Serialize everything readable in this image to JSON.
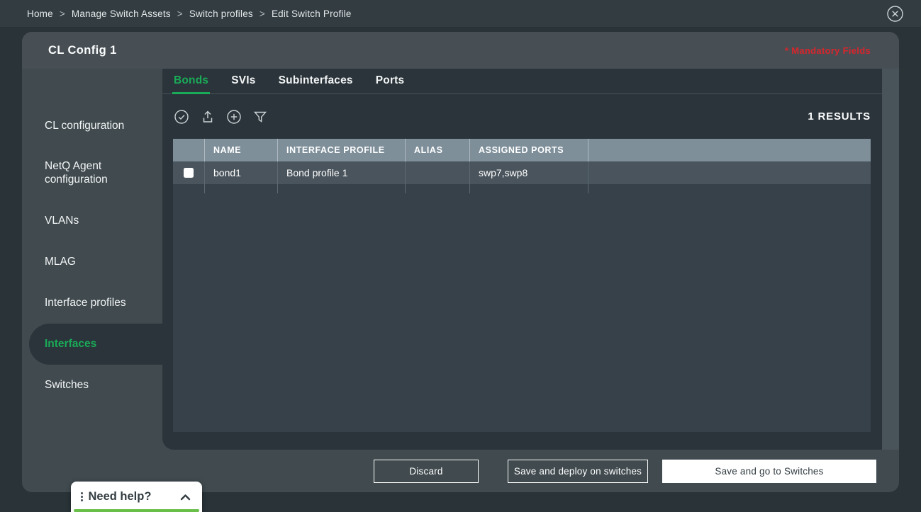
{
  "topbar": {
    "breadcrumb": [
      "Home",
      "Manage Switch Assets",
      "Switch profiles",
      "Edit Switch Profile"
    ],
    "separator": ">"
  },
  "panel": {
    "title": "CL Config 1",
    "mandatory_note": "* Mandatory Fields"
  },
  "sidebar": {
    "items": [
      {
        "label": "CL configuration",
        "selected": false
      },
      {
        "label": "NetQ Agent configuration",
        "selected": false
      },
      {
        "label": "VLANs",
        "selected": false
      },
      {
        "label": "MLAG",
        "selected": false
      },
      {
        "label": "Interface profiles",
        "selected": false
      },
      {
        "label": "Interfaces",
        "selected": true
      },
      {
        "label": "Switches",
        "selected": false
      }
    ]
  },
  "tabs": [
    {
      "label": "Bonds",
      "active": true
    },
    {
      "label": "SVIs",
      "active": false
    },
    {
      "label": "Subinterfaces",
      "active": false
    },
    {
      "label": "Ports",
      "active": false
    }
  ],
  "toolbar": {
    "icons": [
      "select-check-icon",
      "upload-icon",
      "add-circle-icon",
      "filter-icon"
    ],
    "results_label": "1 RESULTS"
  },
  "table": {
    "columns": [
      "NAME",
      "INTERFACE PROFILE",
      "ALIAS",
      "ASSIGNED PORTS"
    ],
    "rows": [
      {
        "name": "bond1",
        "interface_profile": "Bond profile 1",
        "alias": "",
        "assigned_ports": "swp7,swp8",
        "checked": false
      }
    ]
  },
  "footer": {
    "buttons": [
      {
        "label": "Discard",
        "variant": "outline"
      },
      {
        "label": "Save and deploy on switches",
        "variant": "outline"
      },
      {
        "label": "Save and go to Switches",
        "variant": "primary"
      }
    ]
  },
  "help_widget": {
    "label": "Need help?",
    "state": "collapsed"
  },
  "colors": {
    "accent_green": "#1aab58",
    "help_green": "#6abf4b",
    "mandatory_red": "#d9252b",
    "table_header": "#7e8f9a",
    "panel_bg": "#404a4f",
    "content_bg": "#2a343a"
  }
}
